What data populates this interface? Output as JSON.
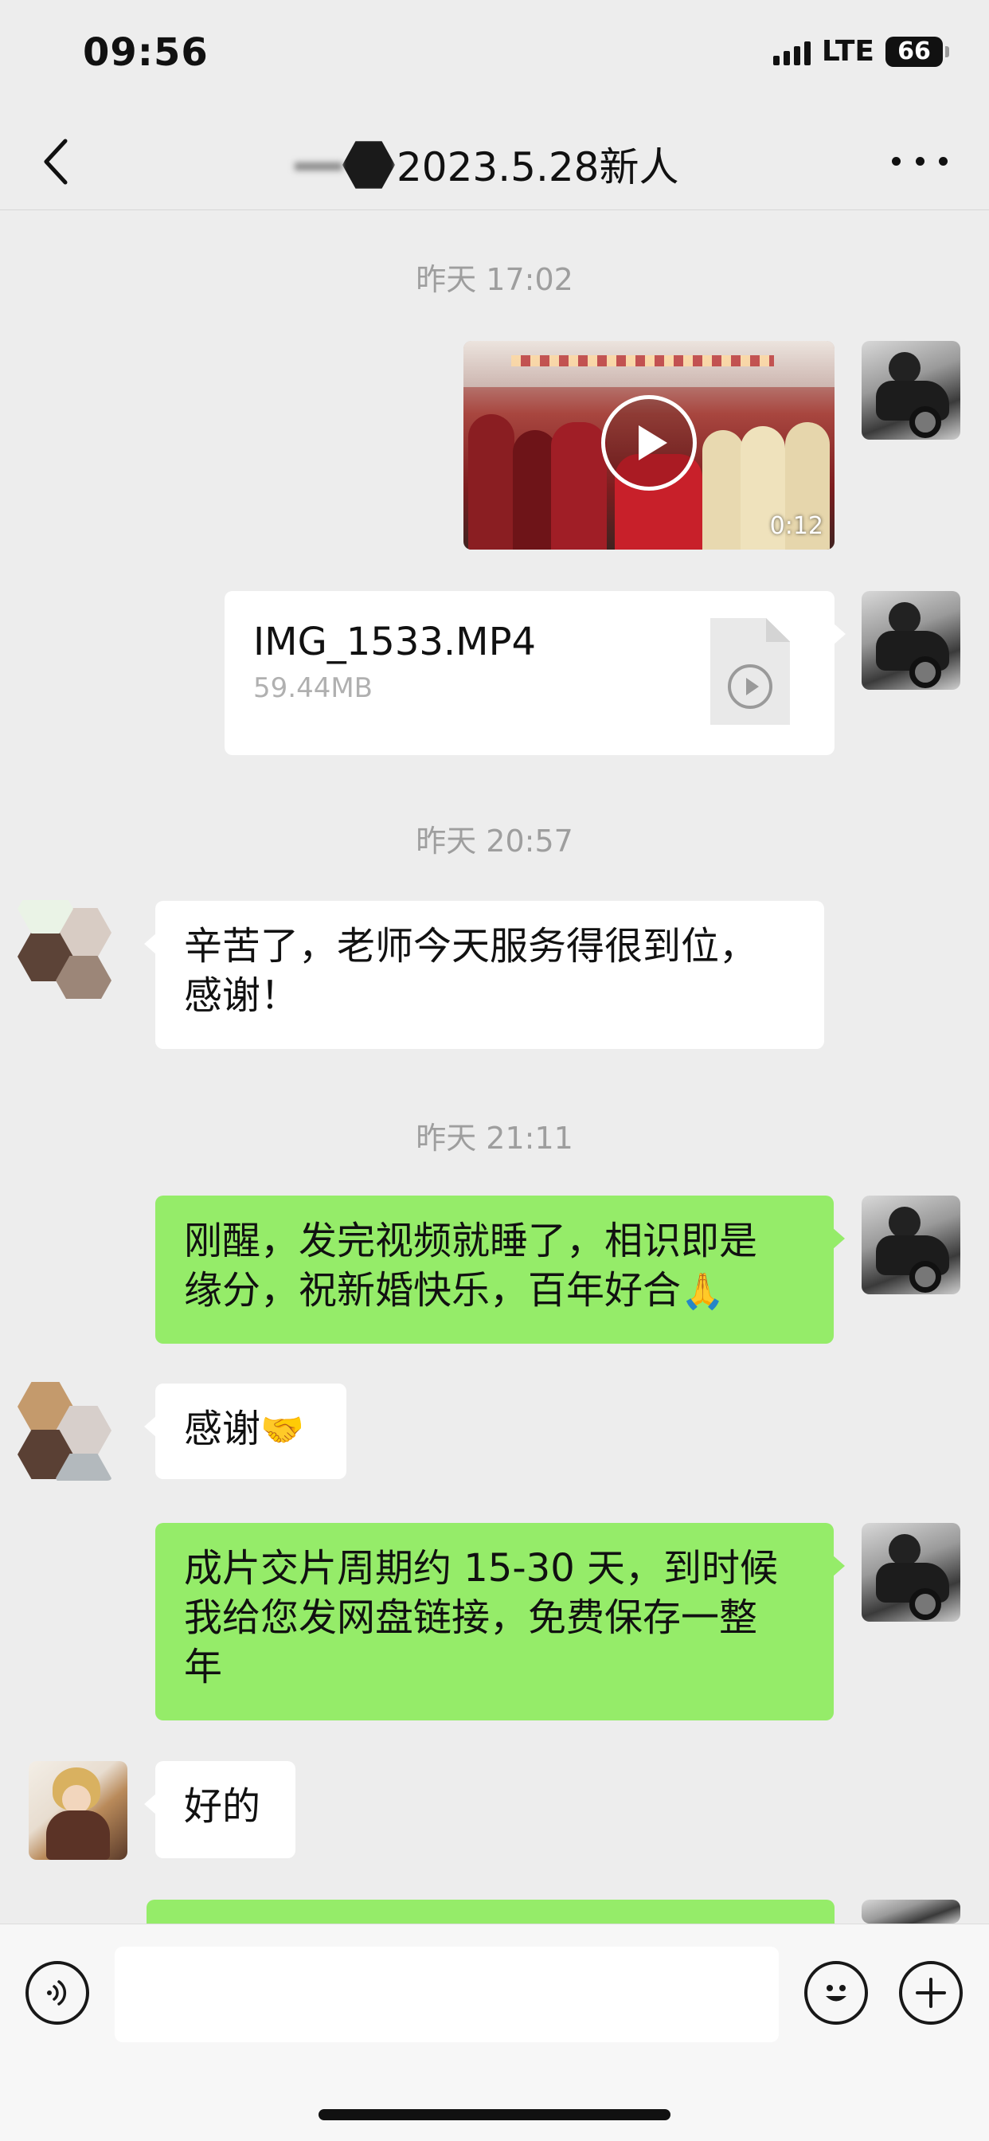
{
  "status_bar": {
    "time": "09:56",
    "network": "LTE",
    "battery": "66"
  },
  "nav": {
    "title": "2023.5.28新人"
  },
  "messages": {
    "ts1": "昨天 17:02",
    "video": {
      "duration": "0:12"
    },
    "file": {
      "name": "IMG_1533.MP4",
      "size": "59.44MB"
    },
    "ts2": "昨天 20:57",
    "m1": {
      "line1": "辛苦了，老师今天服务得很到位，",
      "line2": "感谢！"
    },
    "ts3": "昨天 21:11",
    "m2": {
      "line1": "刚醒，发完视频就睡了，相识即是",
      "line2": "缘分，祝新婚快乐，百年好合",
      "emoji": "🙏"
    },
    "m3": {
      "text": "感谢",
      "emoji": "🤝"
    },
    "m4": {
      "line1": "成片交片周期约 15-30 天，到时候",
      "line2": "我给您发网盘链接，免费保存一整",
      "line3": "年"
    },
    "m5": {
      "text": "好的"
    }
  },
  "input": {
    "value": ""
  },
  "colors": {
    "green_bubble": "#95ec69",
    "background": "#ededed",
    "white_bubble": "#ffffff"
  },
  "icons": [
    "back-icon",
    "more-icon",
    "play-icon",
    "video-file-icon",
    "voice-icon",
    "emoji-icon",
    "plus-icon"
  ]
}
